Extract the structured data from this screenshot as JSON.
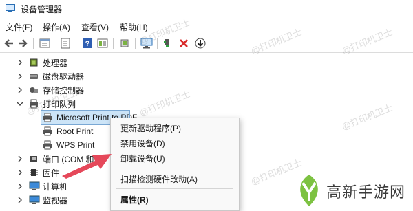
{
  "window": {
    "title": "设备管理器",
    "icon": "device-manager-icon"
  },
  "menu": [
    {
      "label": "文件(F)"
    },
    {
      "label": "操作(A)"
    },
    {
      "label": "查看(V)"
    },
    {
      "label": "帮助(H)"
    }
  ],
  "toolbar": {
    "icons": [
      "back-arrow-icon",
      "forward-arrow-icon",
      "properties-icon",
      "update-driver-icon",
      "help-icon",
      "view-icon",
      "scan-hardware-icon",
      "monitor-icon",
      "add-driver-icon",
      "uninstall-x-icon",
      "download-icon"
    ]
  },
  "tree": {
    "processor": "处理器",
    "disk": "磁盘驱动器",
    "storage": "存储控制器",
    "print_queue": "打印队列",
    "printer1": "Microsoft Print to PDF",
    "printer2": "Root Print",
    "printer3": "WPS Print",
    "ports": "端口 (COM 和",
    "firmware": "固件",
    "computer": "计算机",
    "monitor": "监视器"
  },
  "context_menu": {
    "update": "更新驱动程序(P)",
    "disable": "禁用设备(D)",
    "uninstall": "卸载设备(U)",
    "scan": "扫描检测硬件改动(A)",
    "properties": "属性(R)"
  },
  "watermark": "@打印机卫士",
  "logo": {
    "text": "高新手游网",
    "accent": "#7dc242"
  },
  "colors": {
    "selection": "#cce4f7",
    "arrow": "#e5485a",
    "uninstall_red": "#d92b2b"
  }
}
